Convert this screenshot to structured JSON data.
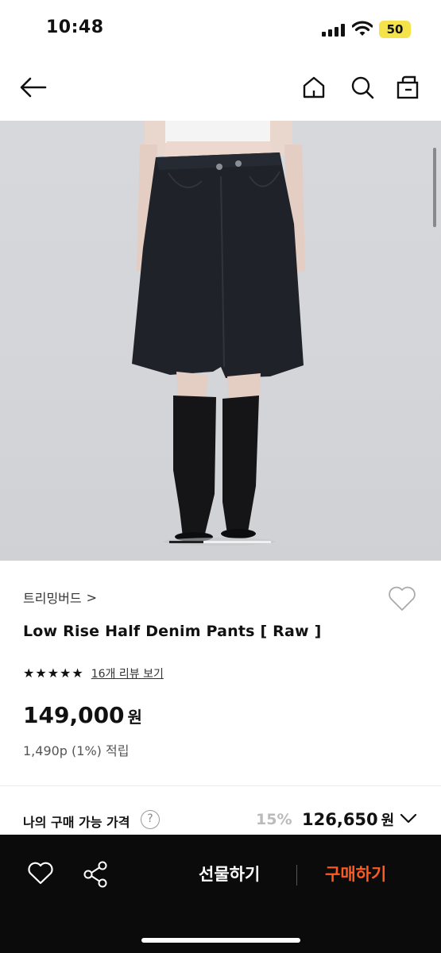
{
  "status_bar": {
    "time": "10:48",
    "battery": "50",
    "icons": [
      "cellular-signal-icon",
      "wifi-icon",
      "battery-icon"
    ]
  },
  "header": {
    "icons": [
      "back-arrow-icon",
      "home-icon",
      "search-icon",
      "shopping-bag-icon"
    ]
  },
  "gallery": {
    "image": "product-photo",
    "pager_position": 1,
    "pager_total": 3
  },
  "product": {
    "brand": "트리밍버드",
    "brand_chevron": ">",
    "title": "Low Rise Half Denim Pants [ Raw ]",
    "rating_stars": 5,
    "review_link": "16개 리뷰 보기",
    "price": "149,000",
    "price_unit": "원",
    "points": "1,490p (1%) 적립"
  },
  "my_price": {
    "label": "나의 구매 가능 가격",
    "help": "?",
    "discount": "15%",
    "price": "126,650",
    "unit": "원"
  },
  "bottom_bar": {
    "gift_label": "선물하기",
    "buy_label": "구매하기"
  },
  "colors": {
    "accent": "#ff5a1f",
    "bottom_bar_bg": "#0b0b0b",
    "battery": "#f4e34b"
  }
}
